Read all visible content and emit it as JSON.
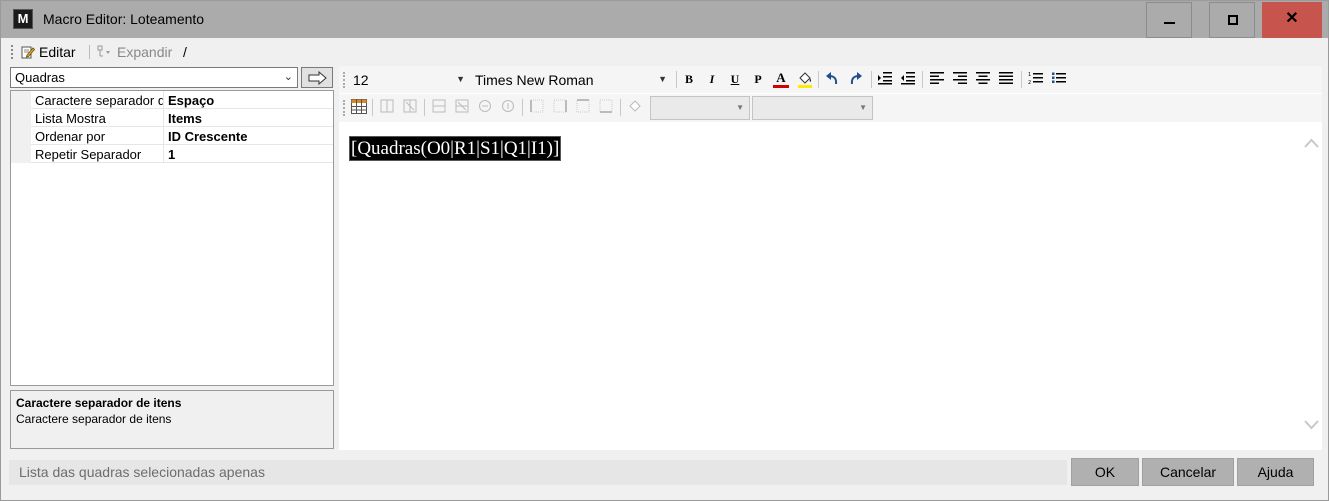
{
  "window": {
    "app_icon_letter": "M",
    "title": "Macro Editor: Loteamento",
    "controls": [
      "minimize",
      "maximize",
      "close"
    ]
  },
  "menu": {
    "editar_label": "Editar",
    "expandir_label": "Expandir",
    "slash": "/"
  },
  "left": {
    "combo_value": "Quadras",
    "properties": [
      {
        "name": "Caractere separador de itens",
        "value": "Espaço"
      },
      {
        "name": "Lista Mostra",
        "value": "Items"
      },
      {
        "name": "Ordenar por",
        "value": "ID Crescente"
      },
      {
        "name": "Repetir Separador",
        "value": "1"
      }
    ],
    "description_title": "Caractere separador de itens",
    "description_text": "Caractere separador de itens"
  },
  "editor": {
    "font_size": "12",
    "font_name": "Times New Roman",
    "format_buttons": {
      "bold": "B",
      "italic": "I",
      "underline": "U",
      "paragraph": "P",
      "font_color": "A"
    },
    "content": "[Quadras(O0|R1|S1|Q1|I1)]",
    "icons": [
      "undo-icon",
      "redo-icon",
      "indent-icon",
      "outdent-icon",
      "align-left-icon",
      "align-right-icon",
      "align-center-icon",
      "justify-icon",
      "numbered-list-icon",
      "bullet-list-icon",
      "table-icon"
    ]
  },
  "status": {
    "text": "Lista das quadras selecionadas apenas"
  },
  "buttons": {
    "ok": "OK",
    "cancel": "Cancelar",
    "help": "Ajuda"
  },
  "colors": {
    "titlebar": "#ababab",
    "close": "#c8554d",
    "font_color_underline": "#d40000",
    "highlight_underline": "#ffeb00"
  }
}
